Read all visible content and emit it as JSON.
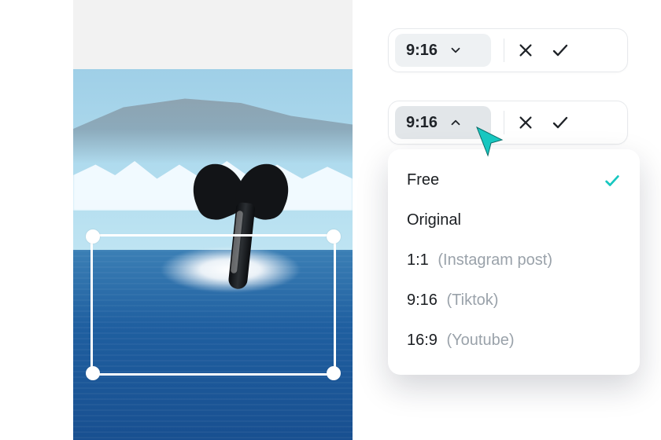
{
  "selectors": {
    "top": {
      "ratio": "9:16"
    },
    "mid": {
      "ratio": "9:16"
    }
  },
  "menu": {
    "opt_free": "Free",
    "opt_original": "Original",
    "opt_1_1_ratio": "1:1",
    "opt_1_1_desc": "(Instagram post)",
    "opt_9_16_ratio": "9:16",
    "opt_9_16_desc": "(Tiktok)",
    "opt_16_9_ratio": "16:9",
    "opt_16_9_desc": "(Youtube)",
    "selected": "Free"
  },
  "colors": {
    "accent": "#17c7c0"
  }
}
